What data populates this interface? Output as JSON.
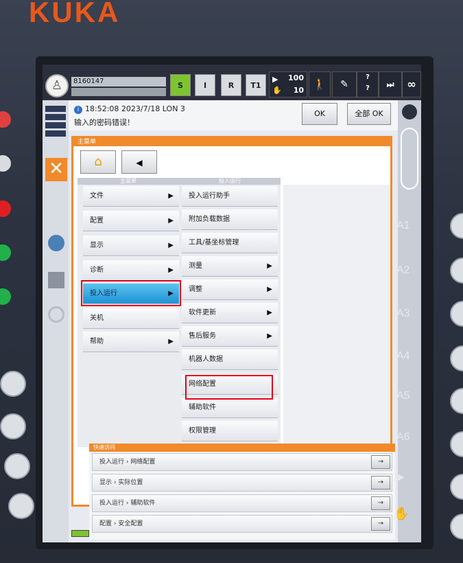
{
  "brand": "KUKA",
  "topbar": {
    "robot_id": "8160147",
    "buttons": [
      "S",
      "I",
      "R",
      "T1"
    ],
    "override_top": "100",
    "override_bottom": "10",
    "infinity": "∞"
  },
  "message": {
    "time": "18:52:08 2023/7/18 LON 3",
    "text": "输入的密码错误！",
    "ok_label": "OK",
    "all_ok_label": "全部 OK"
  },
  "mainmenu": {
    "title": "主菜单",
    "col1_header": "主菜单",
    "col2_header": "投入运行",
    "col1_items": [
      {
        "label": "文件",
        "arrow": "▶"
      },
      {
        "label": "配置",
        "arrow": "▶"
      },
      {
        "label": "显示",
        "arrow": "▶"
      },
      {
        "label": "诊断",
        "arrow": "▶"
      },
      {
        "label": "投入运行",
        "arrow": "▶"
      },
      {
        "label": "关机",
        "arrow": ""
      },
      {
        "label": "帮助",
        "arrow": "▶"
      }
    ],
    "col2_items": [
      {
        "label": "投入运行助手",
        "arrow": ""
      },
      {
        "label": "附加负载数据",
        "arrow": ""
      },
      {
        "label": "工具/基坐标管理",
        "arrow": ""
      },
      {
        "label": "测量",
        "arrow": "▶"
      },
      {
        "label": "调整",
        "arrow": "▶"
      },
      {
        "label": "软件更新",
        "arrow": "▶"
      },
      {
        "label": "售后服务",
        "arrow": "▶"
      },
      {
        "label": "机器人数据",
        "arrow": ""
      },
      {
        "label": "网络配置",
        "arrow": ""
      },
      {
        "label": "辅助软件",
        "arrow": ""
      },
      {
        "label": "权限管理",
        "arrow": ""
      }
    ]
  },
  "quick_access": {
    "title": "快速访问",
    "rows": [
      "投入运行 › 网络配置",
      "显示 › 实际位置",
      "投入运行 › 辅助软件",
      "配置 › 安全配置"
    ],
    "go_icon": "→"
  },
  "axes": [
    "A1",
    "A2",
    "A3",
    "A4",
    "A5",
    "A6"
  ]
}
